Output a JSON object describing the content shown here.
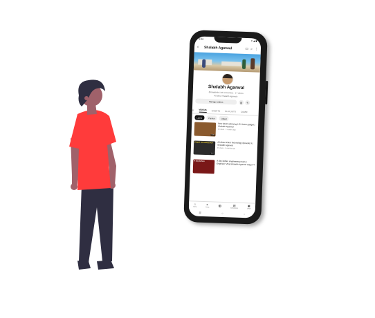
{
  "phone": {
    "status_time": "9:38",
    "status_icons": "▾ ◢ ▮",
    "channel_title": "Shalabh Agarwal",
    "channel_name": "Shalabh Agarwal",
    "channel_meta": "@shalabhb4 3rd subscribers · 17 videos",
    "channel_more": "All about Shalabh Agarwal ›",
    "manage_label": "Manage videos",
    "tabs": [
      "ME",
      "VIDEOS",
      "SHORTS",
      "PLAYLISTS",
      "COMM"
    ],
    "chips": [
      "Latest",
      "Popular",
      "Oldest"
    ],
    "videos": [
      {
        "title": "New latest unboxing 1.0! Home gadget | Shalabh Agarwal",
        "meta": "50 views · 1 months ago",
        "thumb_text": "",
        "duration": "5:08",
        "thumb_color": "#8a5a2e"
      },
      {
        "title": "All About Point Technology Episode 3 | Shalabh Agarwal",
        "meta": "45 views · 5 months ago",
        "thumb_text": "POINT TECHNOLOGY",
        "duration": "8:12",
        "thumb_color": "#2b2b2b"
      },
      {
        "title": "A day before engineering exam | Engineer' Vlog Shalabh Agarwal vlogs #4",
        "meta": "",
        "thumb_text": "A day before",
        "duration": "",
        "thumb_color": "#7a1818"
      }
    ],
    "nav": [
      {
        "icon": "⌂",
        "label": "Home"
      },
      {
        "icon": "▸",
        "label": "Shorts"
      },
      {
        "icon": "⊕",
        "label": ""
      },
      {
        "icon": "▤",
        "label": "Subscriptions"
      },
      {
        "icon": "▣",
        "label": "Library"
      }
    ],
    "sys_nav": [
      "|||",
      "○",
      "‹"
    ]
  },
  "colors": {
    "shirt": "#ff3b3b",
    "pants": "#2f2e41",
    "skin": "#a0616a",
    "hair": "#2f2e41"
  }
}
